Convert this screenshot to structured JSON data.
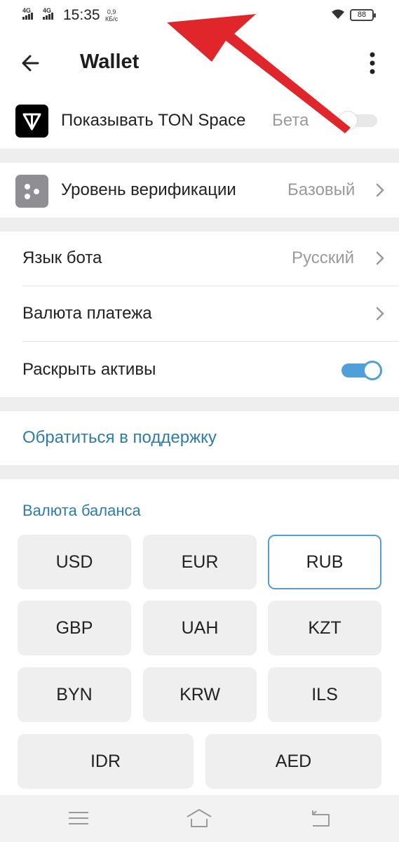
{
  "status_bar": {
    "network_1": "4G",
    "network_2": "4G",
    "time": "15:35",
    "speed_value": "0,9",
    "speed_unit": "КБ/с",
    "battery": "88"
  },
  "header": {
    "title": "Wallet",
    "back_icon": "arrow-left-icon",
    "menu_icon": "more-vertical-icon"
  },
  "ton_space": {
    "label": "Показывать TON Space",
    "badge": "Бета",
    "enabled": false,
    "icon": "ton-logo-icon"
  },
  "verification": {
    "label": "Уровень верификации",
    "value": "Базовый",
    "icon": "dice-icon"
  },
  "settings": {
    "bot_language_label": "Язык бота",
    "bot_language_value": "Русский",
    "payment_currency_label": "Валюта платежа",
    "reveal_assets_label": "Раскрыть активы",
    "reveal_assets_enabled": true
  },
  "support": {
    "label": "Обратиться в поддержку"
  },
  "balance_currency": {
    "title": "Валюта баланса",
    "options": [
      "USD",
      "EUR",
      "RUB",
      "GBP",
      "UAH",
      "KZT",
      "BYN",
      "KRW",
      "ILS",
      "IDR",
      "AED"
    ],
    "selected": "RUB"
  },
  "colors": {
    "accent": "#4fa0da",
    "link": "#2d7da8",
    "annotation_arrow": "#e0262b"
  }
}
